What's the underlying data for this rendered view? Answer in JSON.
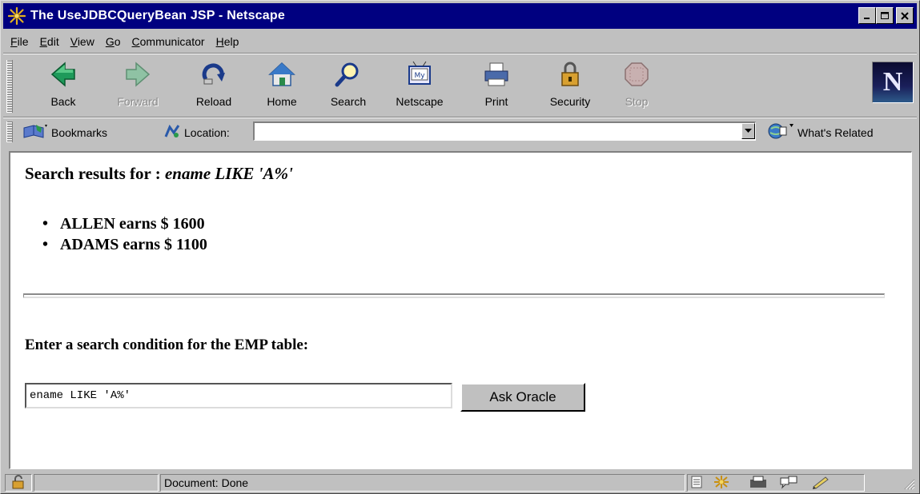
{
  "window": {
    "title": "The UseJDBCQueryBean JSP - Netscape",
    "app_icon": "netscape-star-icon",
    "controls": [
      "minimize",
      "maximize",
      "close"
    ]
  },
  "menubar": {
    "items": [
      {
        "label": "File",
        "accel": "F",
        "rest": "ile"
      },
      {
        "label": "Edit",
        "accel": "E",
        "rest": "dit"
      },
      {
        "label": "View",
        "accel": "V",
        "rest": "iew"
      },
      {
        "label": "Go",
        "accel": "G",
        "rest": "o"
      },
      {
        "label": "Communicator",
        "accel": "C",
        "rest": "ommunicator"
      },
      {
        "label": "Help",
        "accel": "H",
        "rest": "elp"
      }
    ]
  },
  "toolbar": {
    "buttons": [
      {
        "label": "Back",
        "icon": "back-arrow-icon",
        "enabled": true
      },
      {
        "label": "Forward",
        "icon": "forward-arrow-icon",
        "enabled": false
      },
      {
        "label": "Reload",
        "icon": "reload-icon",
        "enabled": true
      },
      {
        "label": "Home",
        "icon": "home-icon",
        "enabled": true
      },
      {
        "label": "Search",
        "icon": "search-icon",
        "enabled": true
      },
      {
        "label": "Netscape",
        "icon": "my-netscape-icon",
        "enabled": true
      },
      {
        "label": "Print",
        "icon": "printer-icon",
        "enabled": true
      },
      {
        "label": "Security",
        "icon": "padlock-icon",
        "enabled": true
      },
      {
        "label": "Stop",
        "icon": "stop-icon",
        "enabled": false
      }
    ],
    "logo_letter": "N"
  },
  "locationbar": {
    "bookmarks_label": "Bookmarks",
    "location_label": "Location:",
    "location_value": "",
    "related_label": "What's Related"
  },
  "page": {
    "results_heading_prefix": "Search results for :",
    "results_heading_query": "ename LIKE 'A%'",
    "results": [
      "ALLEN earns $ 1600",
      "ADAMS earns $ 1100"
    ],
    "prompt": "Enter a search condition for the EMP table:",
    "search_value": "ename LIKE 'A%'",
    "submit_label": "Ask Oracle"
  },
  "statusbar": {
    "status_text": "Document: Done"
  }
}
